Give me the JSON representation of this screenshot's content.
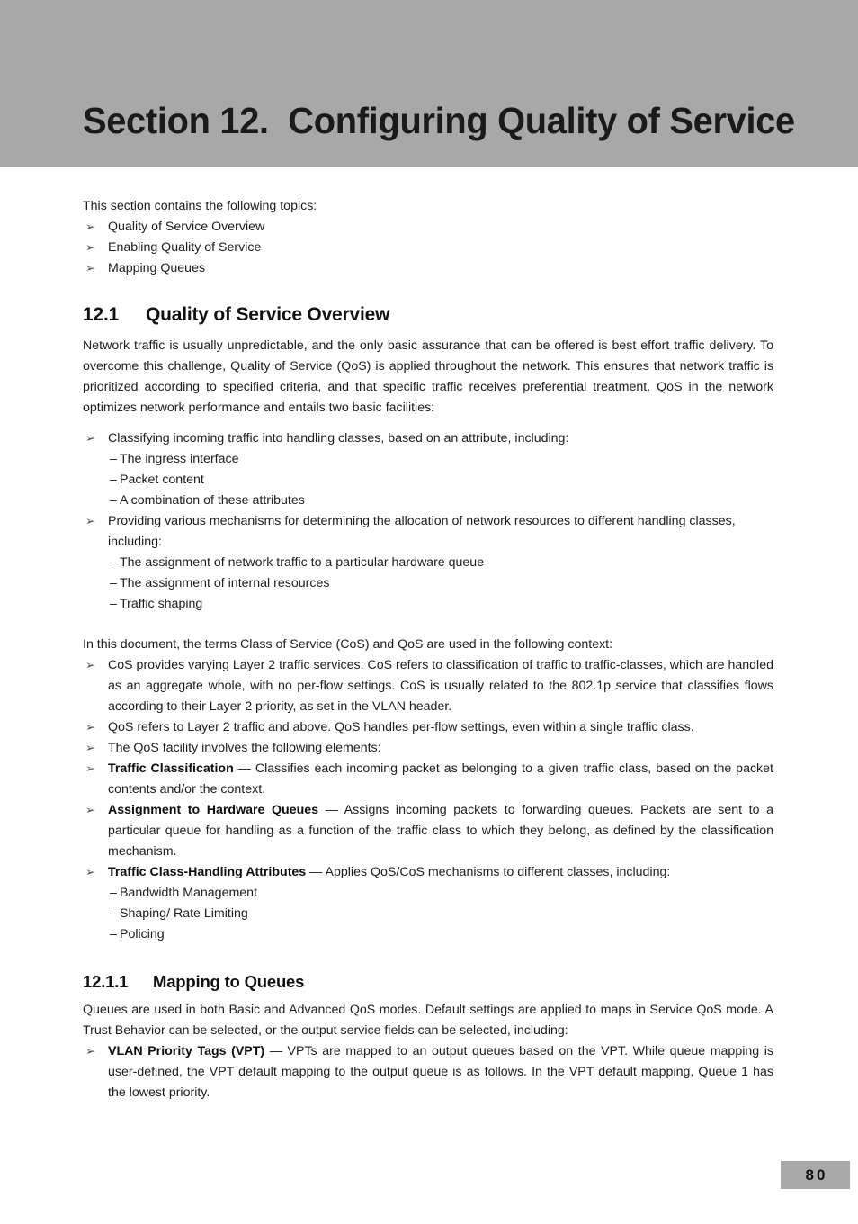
{
  "banner": {
    "title": "Section 12.  Configuring Quality of Service",
    "background_color": "#a8a8a8"
  },
  "intro": {
    "lead": "This section contains the following topics:",
    "topics": [
      "Quality of Service Overview",
      "Enabling Quality of Service",
      "Mapping Queues"
    ]
  },
  "section_12_1": {
    "number": "12.1",
    "title": "Quality of Service Overview",
    "paragraph": "Network traffic is usually unpredictable, and the only basic assurance that can be offered is best effort traffic delivery. To overcome this challenge, Quality of Service (QoS) is applied throughout the network. This ensures that network traffic is prioritized according to specified criteria, and that specific traffic receives preferential treatment. QoS in the network optimizes network performance and entails two basic facilities:",
    "facility_1": {
      "bullet": "Classifying incoming traffic into handling classes, based on an attribute, including:",
      "subitems": [
        "The ingress interface",
        "Packet content",
        "A combination of these attributes"
      ]
    },
    "facility_2": {
      "bullet": "Providing various mechanisms for determining the allocation of network resources to different handling classes, including:",
      "subitems": [
        "The assignment of network traffic to a particular hardware queue",
        "The assignment of internal resources",
        "Traffic shaping"
      ]
    },
    "context_lead": "In this document, the terms Class of Service (CoS) and QoS are used in the following context:",
    "context_bullets": [
      "CoS provides varying Layer 2 traffic services. CoS refers to classification of traffic to traffic-classes, which are handled as an aggregate whole, with no per-flow settings. CoS is usually related to the 802.1p service that classifies flows according to their Layer 2 priority, as set in the VLAN header.",
      "QoS refers to Layer 2 traffic and above. QoS handles per-flow settings, even within a single traffic class.",
      "The QoS facility involves the following elements:"
    ],
    "elements": [
      {
        "label": "Traffic Classification",
        "dash": "—",
        "text": "Classifies each incoming packet as belonging to a given traffic class, based on the packet contents and/or the context."
      },
      {
        "label": "Assignment to Hardware Queues",
        "dash": "—",
        "text": "Assigns incoming packets to forwarding queues. Packets are sent to a particular queue for handling as a function of the traffic class to which they belong, as defined by the classification mechanism."
      },
      {
        "label": "Traffic Class-Handling Attributes",
        "dash": "—",
        "text": "Applies QoS/CoS mechanisms to different classes, including:"
      }
    ],
    "attribute_subitems": [
      "Bandwidth Management",
      "Shaping/ Rate Limiting",
      "Policing"
    ]
  },
  "section_12_1_1": {
    "number": "12.1.1",
    "title": "Mapping to Queues",
    "paragraph": "Queues are used in both Basic and Advanced QoS modes. Default settings are applied to maps in Service QoS mode. A Trust Behavior can be selected, or the output service fields can be selected, including:",
    "vpt": {
      "label": "VLAN Priority Tags (VPT)",
      "dash": "—",
      "text": "VPTs are mapped to an output queues based on the VPT. While queue mapping is user-defined, the VPT default mapping to the output queue is as follows. In the VPT default mapping, Queue 1 has the lowest priority."
    }
  },
  "footer": {
    "page_number": "80"
  },
  "glyphs": {
    "arrow_bullet": "➢",
    "dash_bullet": "–"
  }
}
